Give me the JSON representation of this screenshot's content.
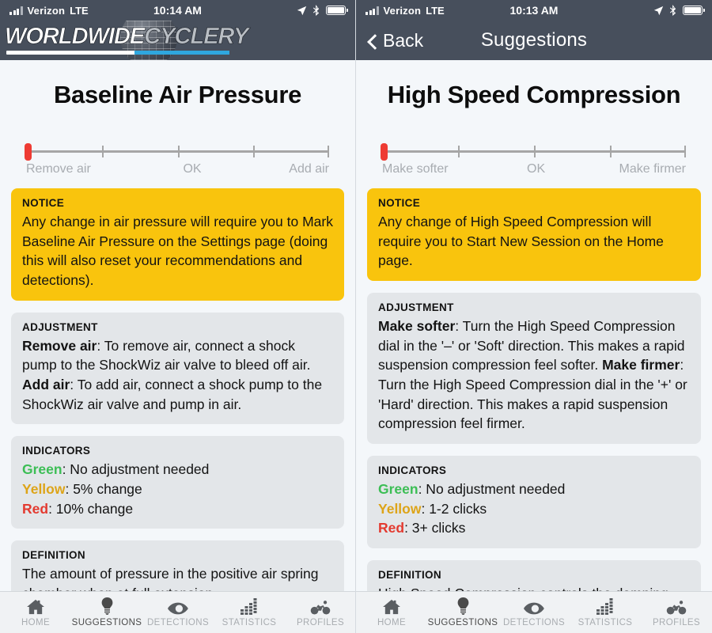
{
  "colors": {
    "header_bg": "#474F5C",
    "page_bg": "#F4F7FA",
    "card_gray": "#E3E6E9",
    "notice_yellow": "#F9C40D",
    "slider_marker_red": "#EE3B33",
    "indicator_green": "#3CBE55",
    "indicator_yellow": "#DDA418",
    "indicator_red": "#E33A30",
    "tab_active": "#4A4A4A",
    "tab_inactive": "#A9ADB1",
    "logo_accent_blue": "#2FA7DE"
  },
  "left_panel": {
    "status_bar": {
      "carrier": "Verizon",
      "network": "LTE",
      "time": "10:14 AM",
      "icons": [
        "signal-bars-icon",
        "location-arrow-icon",
        "bluetooth-icon",
        "battery-icon"
      ]
    },
    "brand": {
      "word_one": "WORLDWIDE",
      "word_two": "CYCLERY"
    },
    "title": "Baseline Air Pressure",
    "slider": {
      "label_left": "Remove air",
      "label_center": "OK",
      "label_right": "Add air",
      "marker_position_percent": 0,
      "tick_count": 5
    },
    "cards": [
      {
        "id": "notice",
        "style": "yellow",
        "heading": "NOTICE",
        "body": "Any change in air pressure will require you to Mark Baseline Air Pressure on the Settings page (doing this will also reset your recommendations and detections)."
      },
      {
        "id": "adjustment",
        "style": "gray",
        "heading": "ADJUSTMENT",
        "lines": [
          {
            "bold": "Remove air",
            "rest": ": To remove air, connect a shock pump to the ShockWiz air valve to bleed off air."
          },
          {
            "bold": "Add air",
            "rest": ": To add air, connect a shock pump to the ShockWiz air valve and pump in air."
          }
        ]
      },
      {
        "id": "indicators",
        "style": "gray",
        "heading": "INDICATORS",
        "rows": [
          {
            "color_word": "Green",
            "color_class": "g",
            "text": ": No adjustment needed"
          },
          {
            "color_word": "Yellow",
            "color_class": "y",
            "text": ": 5% change"
          },
          {
            "color_word": "Red",
            "color_class": "r",
            "text": ": 10% change"
          }
        ]
      },
      {
        "id": "definition",
        "style": "gray",
        "heading": "DEFINITION",
        "body": "The amount of pressure in the positive air spring chamber when at full extension."
      }
    ]
  },
  "right_panel": {
    "status_bar": {
      "carrier": "Verizon",
      "network": "LTE",
      "time": "10:13 AM",
      "icons": [
        "signal-bars-icon",
        "location-arrow-icon",
        "bluetooth-icon",
        "battery-icon"
      ]
    },
    "nav": {
      "back_label": "Back",
      "title": "Suggestions"
    },
    "title": "High Speed Compression",
    "slider": {
      "label_left": "Make softer",
      "label_center": "OK",
      "label_right": "Make firmer",
      "marker_position_percent": 0,
      "tick_count": 5
    },
    "cards": [
      {
        "id": "notice",
        "style": "yellow",
        "heading": "NOTICE",
        "body": "Any change of High Speed Compression will require you to Start New Session on the Home page."
      },
      {
        "id": "adjustment",
        "style": "gray",
        "heading": "ADJUSTMENT",
        "lines": [
          {
            "bold": "Make softer",
            "rest": ": Turn the High Speed Compression dial in the '–' or 'Soft' direction. This makes a rapid suspension compression feel softer."
          },
          {
            "bold": "Make firmer",
            "rest": ": Turn the High Speed Compression dial in the '+' or 'Hard' direction. This makes a rapid suspension compression feel firmer."
          }
        ]
      },
      {
        "id": "indicators",
        "style": "gray",
        "heading": "INDICATORS",
        "rows": [
          {
            "color_word": "Green",
            "color_class": "g",
            "text": ": No adjustment needed"
          },
          {
            "color_word": "Yellow",
            "color_class": "y",
            "text": ": 1-2 clicks"
          },
          {
            "color_word": "Red",
            "color_class": "r",
            "text": ": 3+ clicks"
          }
        ]
      },
      {
        "id": "definition",
        "style": "gray",
        "heading": "DEFINITION",
        "body": "High Speed Compression controls the damping force during fast compression movements."
      }
    ]
  },
  "tab_bar": {
    "tabs": [
      {
        "id": "home",
        "label": "HOME",
        "icon": "house-icon",
        "active": false
      },
      {
        "id": "suggestions",
        "label": "SUGGESTIONS",
        "icon": "lightbulb-icon",
        "active": true
      },
      {
        "id": "detections",
        "label": "DETECTIONS",
        "icon": "eye-icon",
        "active": false
      },
      {
        "id": "statistics",
        "label": "STATISTICS",
        "icon": "bar-chart-icon",
        "active": false
      },
      {
        "id": "profiles",
        "label": "PROFILES",
        "icon": "cyclist-icon",
        "active": false
      }
    ]
  }
}
